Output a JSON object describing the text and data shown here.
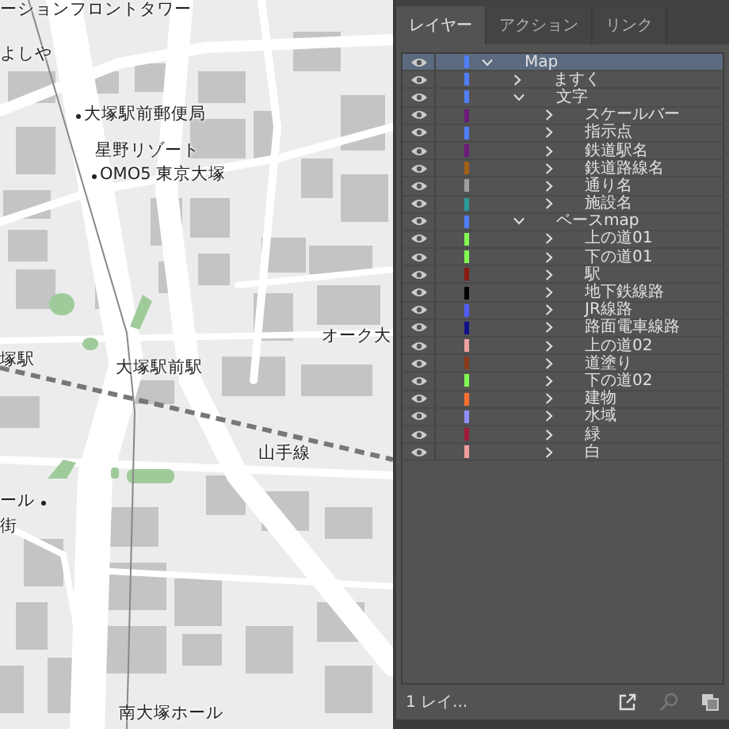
{
  "map": {
    "labels": [
      {
        "text": "ーションフロントタワー",
        "dot": false
      },
      {
        "text": "よしや",
        "dot": false
      },
      {
        "text": "大塚駅前郵便局",
        "dot": true
      },
      {
        "text": "星野リゾート",
        "dot": false
      },
      {
        "text": "OMO5 東京大塚",
        "dot": true
      },
      {
        "text": "オーク大",
        "dot": false
      },
      {
        "text": "塚駅",
        "dot": false
      },
      {
        "text": "大塚駅前駅",
        "dot": false
      },
      {
        "text": "山手線",
        "dot": false
      },
      {
        "text": "ール",
        "dot": true
      },
      {
        "text": "街",
        "dot": false
      },
      {
        "text": "南大塚ホール",
        "dot": false
      }
    ]
  },
  "panel": {
    "tabs": [
      {
        "label": "レイヤー",
        "selected": true
      },
      {
        "label": "アクション",
        "selected": false
      },
      {
        "label": "リンク",
        "selected": false
      }
    ],
    "layers": [
      {
        "name": "Map",
        "color": "#4f7fff",
        "visible": true,
        "expanded": true,
        "selected": true,
        "children": [
          {
            "name": "ますく",
            "color": "#4f7fff",
            "visible": true,
            "expanded": false,
            "selected": false
          },
          {
            "name": "文字",
            "color": "#4f7fff",
            "visible": true,
            "expanded": true,
            "selected": false,
            "children": [
              {
                "name": "スケールバー",
                "color": "#6b1a7a",
                "visible": true,
                "expanded": false,
                "selected": false
              },
              {
                "name": "指示点",
                "color": "#4f7fff",
                "visible": true,
                "expanded": false,
                "selected": false
              },
              {
                "name": "鉄道駅名",
                "color": "#6b1a7a",
                "visible": true,
                "expanded": false,
                "selected": false
              },
              {
                "name": "鉄道路線名",
                "color": "#a0601a",
                "visible": true,
                "expanded": false,
                "selected": false
              },
              {
                "name": "通り名",
                "color": "#a0a0a0",
                "visible": true,
                "expanded": false,
                "selected": false
              },
              {
                "name": "施設名",
                "color": "#2a9a9a",
                "visible": true,
                "expanded": false,
                "selected": false
              }
            ]
          },
          {
            "name": "ベースmap",
            "color": "#4f7fff",
            "visible": true,
            "expanded": true,
            "selected": false,
            "children": [
              {
                "name": "上の道01",
                "color": "#80ff50",
                "visible": true,
                "expanded": false,
                "selected": false
              },
              {
                "name": "下の道01",
                "color": "#80ff50",
                "visible": true,
                "expanded": false,
                "selected": false
              },
              {
                "name": "駅",
                "color": "#8a1a10",
                "visible": true,
                "expanded": false,
                "selected": false
              },
              {
                "name": "地下鉄線路",
                "color": "#000000",
                "visible": true,
                "expanded": false,
                "selected": false
              },
              {
                "name": "JR線路",
                "color": "#4f5fff",
                "visible": true,
                "expanded": false,
                "selected": false
              },
              {
                "name": "路面電車線路",
                "color": "#10108a",
                "visible": true,
                "expanded": false,
                "selected": false
              },
              {
                "name": "上の道02",
                "color": "#f0a0a0",
                "visible": true,
                "expanded": false,
                "selected": false
              },
              {
                "name": "道塗り",
                "color": "#8a3a1a",
                "visible": true,
                "expanded": false,
                "selected": false
              },
              {
                "name": "下の道02",
                "color": "#80ff50",
                "visible": true,
                "expanded": false,
                "selected": false
              },
              {
                "name": "建物",
                "color": "#ff7030",
                "visible": true,
                "expanded": false,
                "selected": false
              },
              {
                "name": "水域",
                "color": "#9090ff",
                "visible": true,
                "expanded": false,
                "selected": false
              },
              {
                "name": "緑",
                "color": "#a01a3a",
                "visible": true,
                "expanded": false,
                "selected": false
              },
              {
                "name": "白",
                "color": "#f0a0a0",
                "visible": true,
                "expanded": false,
                "selected": false
              }
            ]
          }
        ]
      }
    ],
    "footer": {
      "count": "1 レイ..."
    }
  }
}
